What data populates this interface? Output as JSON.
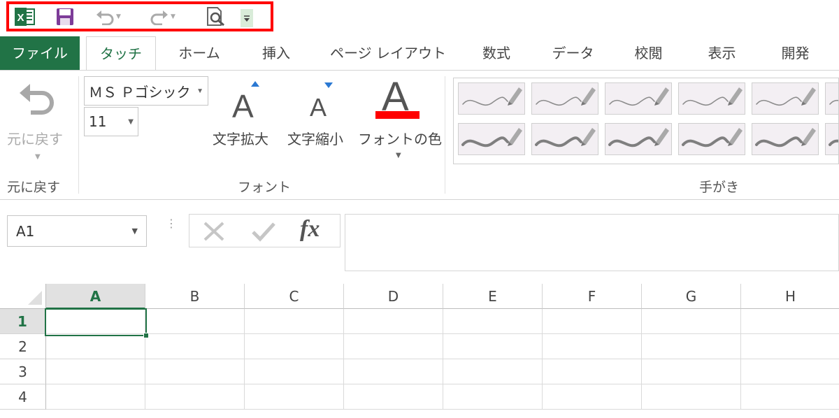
{
  "qat": {
    "icons": [
      "excel-icon",
      "save-icon",
      "undo-icon",
      "redo-icon",
      "print-preview-icon",
      "customize-qat-icon"
    ]
  },
  "tabs": [
    "ファイル",
    "タッチ",
    "ホーム",
    "挿入",
    "ページ レイアウト",
    "数式",
    "データ",
    "校閲",
    "表示",
    "開発"
  ],
  "ribbon": {
    "undo_group": {
      "button_label": "元に戻す",
      "group_label": "元に戻す"
    },
    "font_group": {
      "font_name": "ＭＳ Ｐゴシック",
      "font_size": "11",
      "grow_label": "文字拡大",
      "shrink_label": "文字縮小",
      "color_label": "フォントの色",
      "glyph": "A",
      "group_label": "フォント",
      "font_color": "#ff0000"
    },
    "pens_group": {
      "group_label": "手がき"
    }
  },
  "formula_bar": {
    "name_box": "A1",
    "fx_label": "fx",
    "value": ""
  },
  "sheet": {
    "columns": [
      "A",
      "B",
      "C",
      "D",
      "E",
      "F",
      "G",
      "H"
    ],
    "rows": [
      "1",
      "2",
      "3",
      "4"
    ],
    "active_cell": "A1"
  },
  "colors": {
    "excel_green": "#217346",
    "highlight_red": "#ff0000",
    "accent_blue": "#2b79d3"
  }
}
